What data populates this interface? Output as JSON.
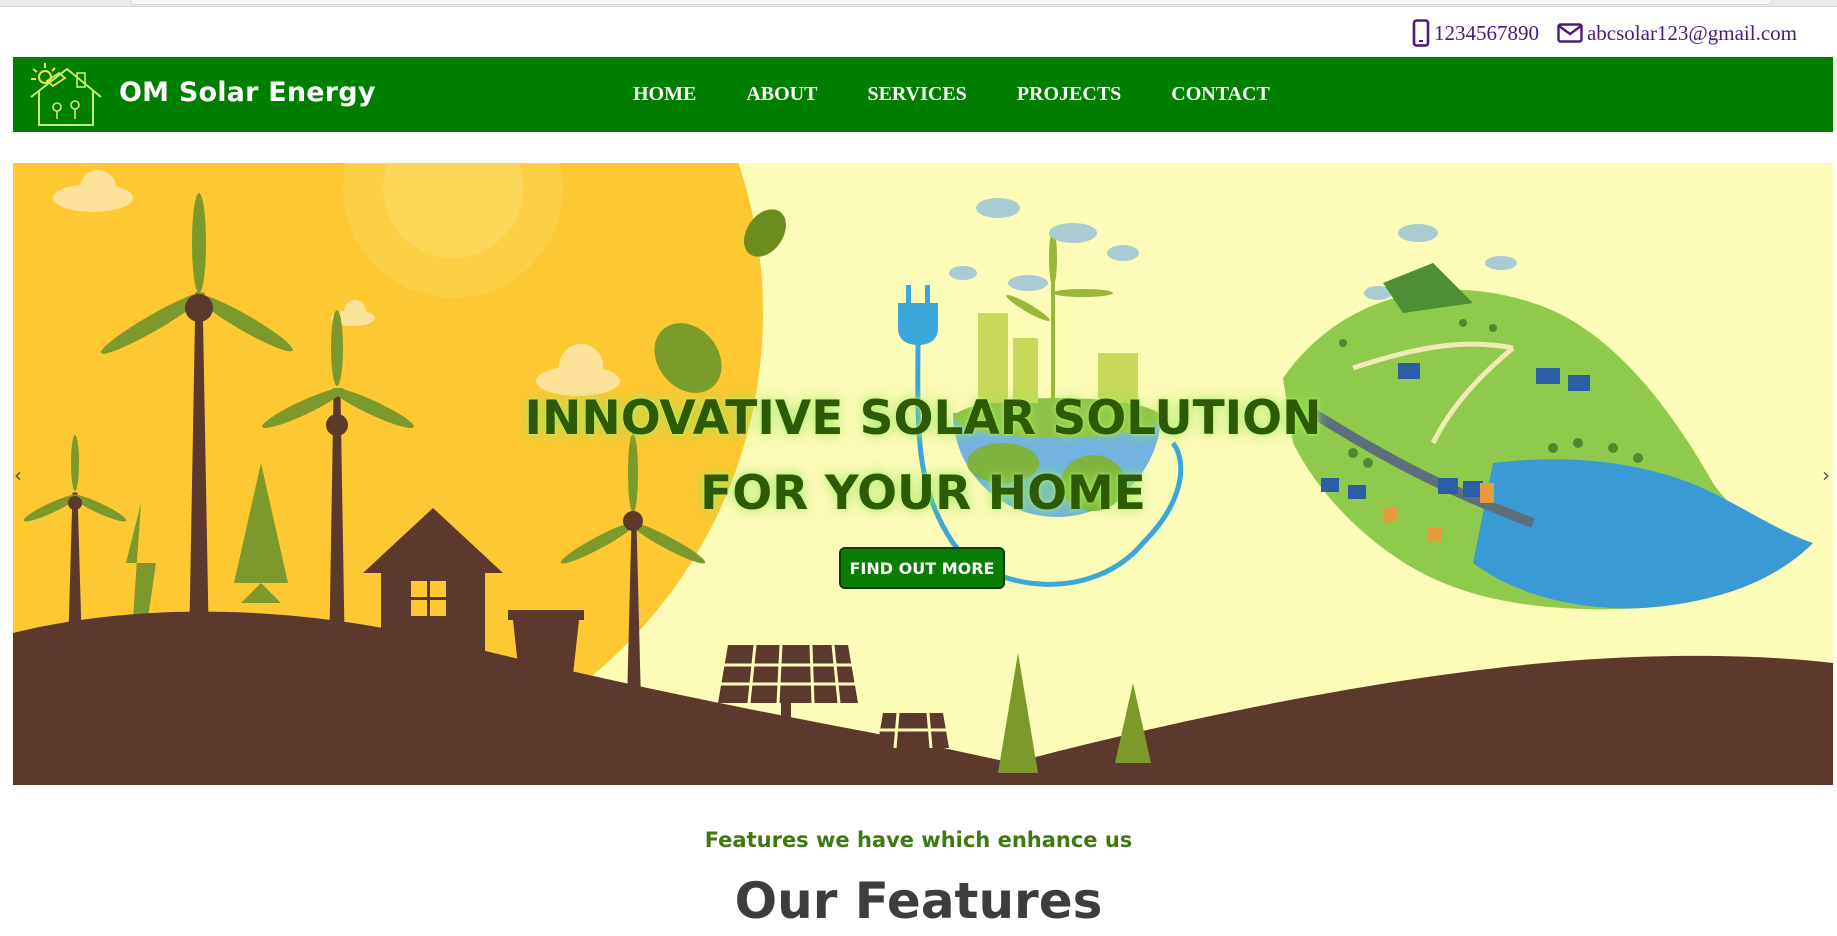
{
  "contact": {
    "phone": "1234567890",
    "email": "abcsolar123@gmail.com",
    "phone_icon": "phone-icon",
    "email_icon": "mail-icon",
    "color": "#4a1a7a"
  },
  "navbar": {
    "brand": "OM Solar Energy",
    "background": "#007e00",
    "links": [
      "HOME",
      "ABOUT",
      "SERVICES",
      "PROJECTS",
      "CONTACT"
    ]
  },
  "hero": {
    "title_line1": "INNOVATIVE SOLAR SOLUTION",
    "title_line2": "FOR YOUR HOME",
    "button_label": "FIND OUT MORE",
    "prev_arrow": "‹",
    "next_arrow": "›",
    "title_color": "#2e5a06"
  },
  "features": {
    "subtitle": "Features we have which enhance us",
    "title": "Our Features"
  }
}
